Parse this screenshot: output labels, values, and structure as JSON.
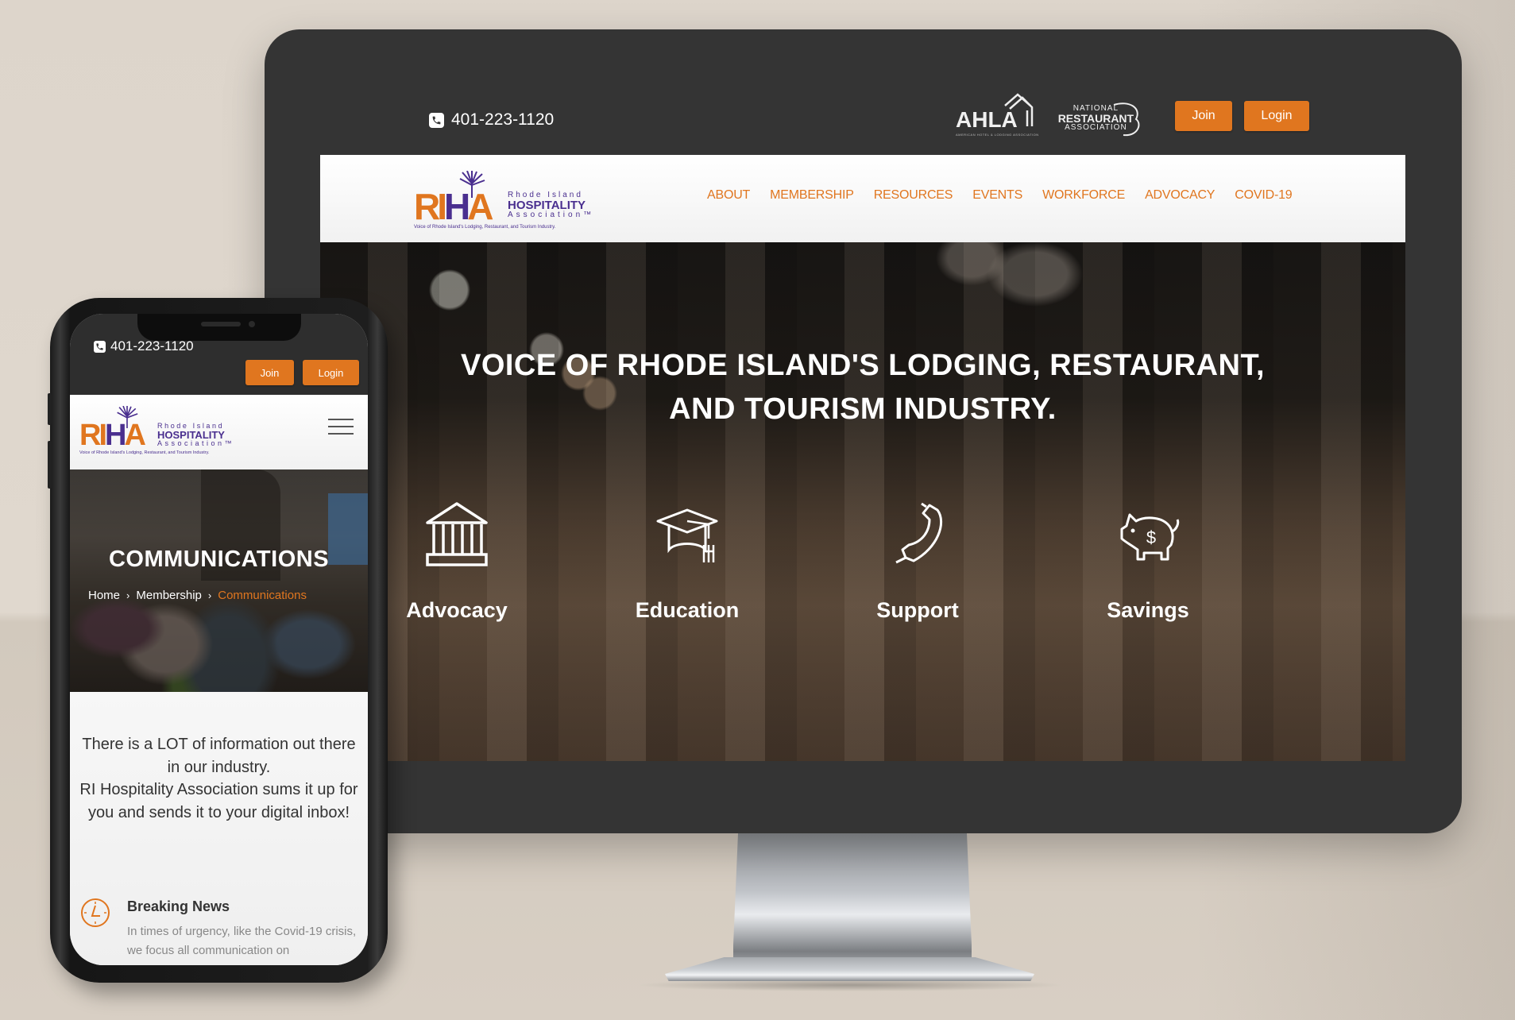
{
  "colors": {
    "accent_orange": "#e0761f",
    "brand_purple": "#4a2f8f",
    "topbar_dark": "#343434"
  },
  "desktop": {
    "topbar": {
      "phone_icon": "phone-icon",
      "phone_number": "401-223-1120",
      "partner_logos": {
        "ahla": {
          "name": "AHLA",
          "subtitle": "AMERICAN HOTEL & LODGING ASSOCIATION"
        },
        "nra": {
          "line1": "NATIONAL",
          "line2": "RESTAURANT",
          "line3": "ASSOCIATION"
        }
      },
      "join_label": "Join",
      "login_label": "Login"
    },
    "logo": {
      "mark_r": "RI",
      "mark_h": "H",
      "mark_a": "A",
      "line1": "Rhode Island",
      "line2": "HOSPITALITY",
      "line3": "Association™",
      "tagline": "Voice of Rhode Island's Lodging, Restaurant, and Tourism Industry."
    },
    "nav": [
      "ABOUT",
      "MEMBERSHIP",
      "RESOURCES",
      "EVENTS",
      "WORKFORCE",
      "ADVOCACY",
      "COVID-19"
    ],
    "hero": {
      "title_line1": "VOICE OF RHODE ISLAND'S LODGING, RESTAURANT,",
      "title_line2": "AND TOURISM INDUSTRY.",
      "features": [
        {
          "label": "Advocacy",
          "icon": "government-building-icon"
        },
        {
          "label": "Education",
          "icon": "graduation-cap-fork-icon"
        },
        {
          "label": "Support",
          "icon": "telephone-handset-icon"
        },
        {
          "label": "Savings",
          "icon": "piggy-bank-icon"
        }
      ]
    }
  },
  "mobile": {
    "topbar": {
      "phone_number": "401-223-1120",
      "join_label": "Join",
      "login_label": "Login"
    },
    "menu_icon": "hamburger-menu-icon",
    "hero": {
      "title": "COMMUNICATIONS",
      "breadcrumb": [
        "Home",
        "Membership",
        "Communications"
      ]
    },
    "intro_text_line1": "There is a LOT of information out there in our industry.",
    "intro_text_line2": "RI Hospitality Association sums it up for you and sends it to your digital inbox!",
    "feature": {
      "icon": "clock-icon",
      "title": "Breaking News",
      "text": "In times of urgency, like the Covid-19 crisis, we focus all communication on"
    }
  }
}
